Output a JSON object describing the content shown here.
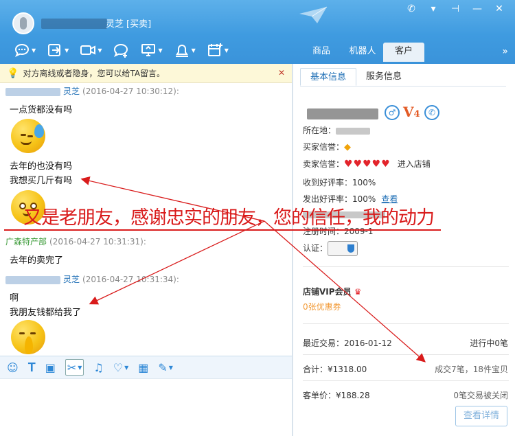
{
  "header": {
    "title_suffix": "灵芝",
    "title_tag": "[买卖]",
    "window_buttons": [
      "✆",
      "▾",
      "⊣",
      "—",
      "✕"
    ],
    "toolbar": [
      {
        "name": "chat-bubble-icon",
        "caret": true
      },
      {
        "name": "send-file-icon",
        "caret": true
      },
      {
        "name": "video-icon",
        "caret": true
      },
      {
        "name": "add-chat-icon",
        "caret": false
      },
      {
        "name": "remote-desktop-icon",
        "caret": true
      },
      {
        "name": "alarm-icon",
        "caret": true
      },
      {
        "name": "calendar-add-icon",
        "caret": true
      }
    ],
    "tabs": [
      {
        "label": "商品",
        "active": false
      },
      {
        "label": "机器人",
        "active": false
      },
      {
        "label": "客户",
        "active": true
      }
    ],
    "tab_more": "»"
  },
  "notice": {
    "text": "对方离线或者隐身，您可以给TA留言。",
    "close": "✕"
  },
  "chat": {
    "messages": [
      {
        "sender": "灵芝",
        "time": "(2016-04-27 10:30:12):",
        "lines": [
          "一点货都没有吗"
        ]
      },
      {
        "sender": "",
        "time": "",
        "lines": [
          "去年的也没有吗",
          "我想买几斤有吗"
        ]
      },
      {
        "sender": "广森特产部",
        "time": "(2016-04-27 10:31:31):",
        "lines": [
          "去年的卖完了"
        ]
      },
      {
        "sender": "灵芝",
        "time": "(2016-04-27 10:31:34):",
        "lines": [
          "啊",
          "我朋友钱都给我了"
        ]
      }
    ]
  },
  "input_toolbar": [
    {
      "name": "emoji-icon",
      "glyph": "☺",
      "caret": false
    },
    {
      "name": "font-icon",
      "glyph": "T",
      "caret": false
    },
    {
      "name": "image-icon",
      "glyph": "▣",
      "caret": false
    },
    {
      "name": "screenshot-scissors-icon",
      "glyph": "✂",
      "caret": true
    },
    {
      "name": "nudge-bell-icon",
      "glyph": "♫",
      "caret": false
    },
    {
      "name": "heart-icon",
      "glyph": "♡",
      "caret": true
    },
    {
      "name": "calculator-icon",
      "glyph": "▦",
      "caret": false
    },
    {
      "name": "quick-reply-icon",
      "glyph": "✎",
      "caret": true
    }
  ],
  "right_panel": {
    "tabs": [
      {
        "label": "基本信息",
        "active": true
      },
      {
        "label": "服务信息",
        "active": false
      }
    ],
    "level": "V",
    "level_num": "4",
    "info": {
      "location_label": "所在地：",
      "buyer_credit_label": "买家信誉：",
      "seller_credit_label": "卖家信誉：",
      "seller_hearts": "♥♥♥♥♥",
      "enter_shop": "进入店铺",
      "received_good_label": "收到好评率：",
      "received_good_value": "100%",
      "given_good_label": "发出好评率：",
      "given_good_value": "100%",
      "view_link": "查看",
      "register_label": "注册时间：",
      "register_value": "2009-1",
      "cert_label": "认证："
    },
    "vip_label": "店铺VIP会员",
    "coupon": "0张优惠券",
    "recent_trade_label": "最近交易：",
    "recent_trade_date": "2016-01-12",
    "in_progress": "进行中0笔",
    "total_label": "合计：",
    "total_value": "¥1318.00",
    "deals": "成交7笔，18件宝贝",
    "avg_label": "客单价：",
    "avg_value": "¥188.28",
    "closed": "0笔交易被关闭",
    "detail_button": "查看详情"
  },
  "annotation": {
    "text": "又是老朋友，感谢忠实的朋友，您的信任，我的动力",
    "color": "#d91b1b"
  }
}
